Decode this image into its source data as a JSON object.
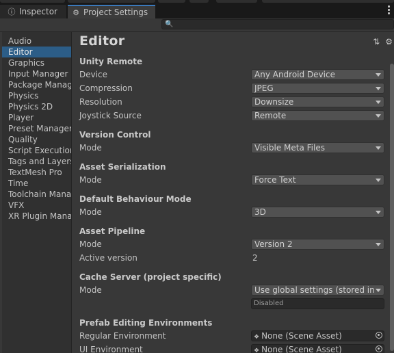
{
  "tabs": [
    {
      "label": "Inspector",
      "icon": "info-icon"
    },
    {
      "label": "Project Settings",
      "icon": "gear-icon"
    }
  ],
  "search": {
    "value": "",
    "icon": "search-icon"
  },
  "sidebar": {
    "items": [
      {
        "label": "Audio"
      },
      {
        "label": "Editor",
        "selected": true
      },
      {
        "label": "Graphics"
      },
      {
        "label": "Input Manager"
      },
      {
        "label": "Package Manager"
      },
      {
        "label": "Physics"
      },
      {
        "label": "Physics 2D"
      },
      {
        "label": "Player"
      },
      {
        "label": "Preset Manager"
      },
      {
        "label": "Quality"
      },
      {
        "label": "Script Execution Order"
      },
      {
        "label": "Tags and Layers"
      },
      {
        "label": "TextMesh Pro"
      },
      {
        "label": "Time"
      },
      {
        "label": "Toolchain Management"
      },
      {
        "label": "VFX"
      },
      {
        "label": "XR Plugin Management"
      }
    ]
  },
  "page": {
    "title": "Editor",
    "header_icons": [
      "sliders-icon",
      "gear-icon"
    ]
  },
  "sections": {
    "unity_remote": {
      "title": "Unity Remote",
      "device_label": "Device",
      "device_value": "Any Android Device",
      "compression_label": "Compression",
      "compression_value": "JPEG",
      "resolution_label": "Resolution",
      "resolution_value": "Downsize",
      "joystick_label": "Joystick Source",
      "joystick_value": "Remote"
    },
    "version_control": {
      "title": "Version Control",
      "mode_label": "Mode",
      "mode_value": "Visible Meta Files"
    },
    "asset_serialization": {
      "title": "Asset Serialization",
      "mode_label": "Mode",
      "mode_value": "Force Text"
    },
    "default_behaviour": {
      "title": "Default Behaviour Mode",
      "mode_label": "Mode",
      "mode_value": "3D"
    },
    "asset_pipeline": {
      "title": "Asset Pipeline",
      "mode_label": "Mode",
      "mode_value": "Version 2",
      "active_label": "Active version",
      "active_value": "2"
    },
    "cache_server": {
      "title": "Cache Server (project specific)",
      "mode_label": "Mode",
      "mode_value": "Use global settings (stored in preferences)",
      "status_value": "Disabled"
    },
    "prefab_env": {
      "title": "Prefab Editing Environments",
      "regular_label": "Regular Environment",
      "regular_value": "None (Scene Asset)",
      "ui_label": "UI Environment",
      "ui_value": "None (Scene Asset)"
    }
  },
  "colors": {
    "background": "#383838",
    "selection": "#2c5d87",
    "active_tab_accent": "#3a79bb",
    "dropdown": "#515151"
  }
}
